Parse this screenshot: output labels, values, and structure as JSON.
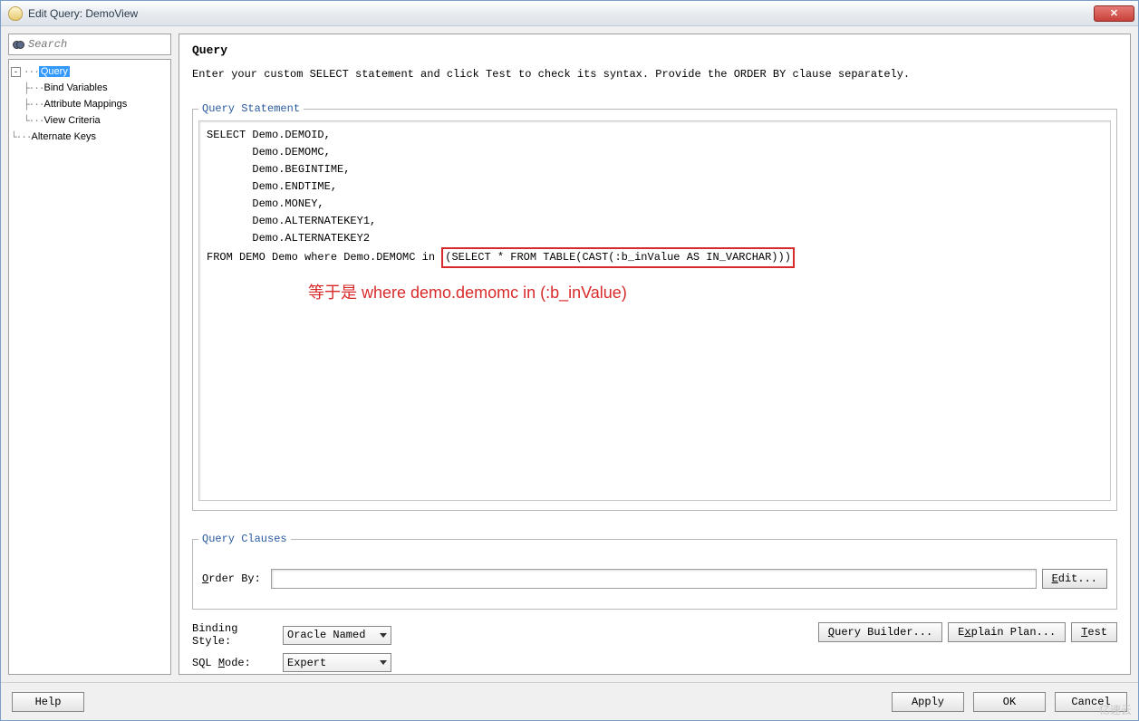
{
  "window": {
    "title": "Edit Query: DemoView"
  },
  "search": {
    "placeholder": "Search"
  },
  "tree": {
    "root": "Query",
    "children": [
      "Bind Variables",
      "Attribute Mappings",
      "View Criteria"
    ],
    "sibling": "Alternate Keys"
  },
  "panel": {
    "title": "Query",
    "description": "Enter your custom SELECT statement and click Test to check its syntax.  Provide the ORDER BY clause separately."
  },
  "statement": {
    "legend": "Query Statement",
    "lines": [
      "SELECT Demo.DEMOID,",
      "       Demo.DEMOMC,",
      "       Demo.BEGINTIME,",
      "       Demo.ENDTIME,",
      "       Demo.MONEY,",
      "       Demo.ALTERNATEKEY1,",
      "       Demo.ALTERNATEKEY2"
    ],
    "from_prefix": "FROM DEMO Demo where Demo.DEMOMC in ",
    "from_highlight": "(SELECT * FROM TABLE(CAST(:b_inValue AS IN_VARCHAR)))",
    "annotation": "等于是 where demo.demomc in (:b_inValue)"
  },
  "clauses": {
    "legend": "Query Clauses",
    "orderby_label": "Order By:",
    "orderby_value": "",
    "edit_btn": "Edit..."
  },
  "options": {
    "binding_label": "Binding Style:",
    "binding_value": "Oracle Named",
    "sqlmode_label": "SQL Mode:",
    "sqlmode_value": "Expert",
    "query_builder": "Query Builder...",
    "explain_plan": "Explain Plan...",
    "test": "Test"
  },
  "footer": {
    "help": "Help",
    "apply": "Apply",
    "ok": "OK",
    "cancel": "Cancel"
  },
  "watermark": "亿速云"
}
